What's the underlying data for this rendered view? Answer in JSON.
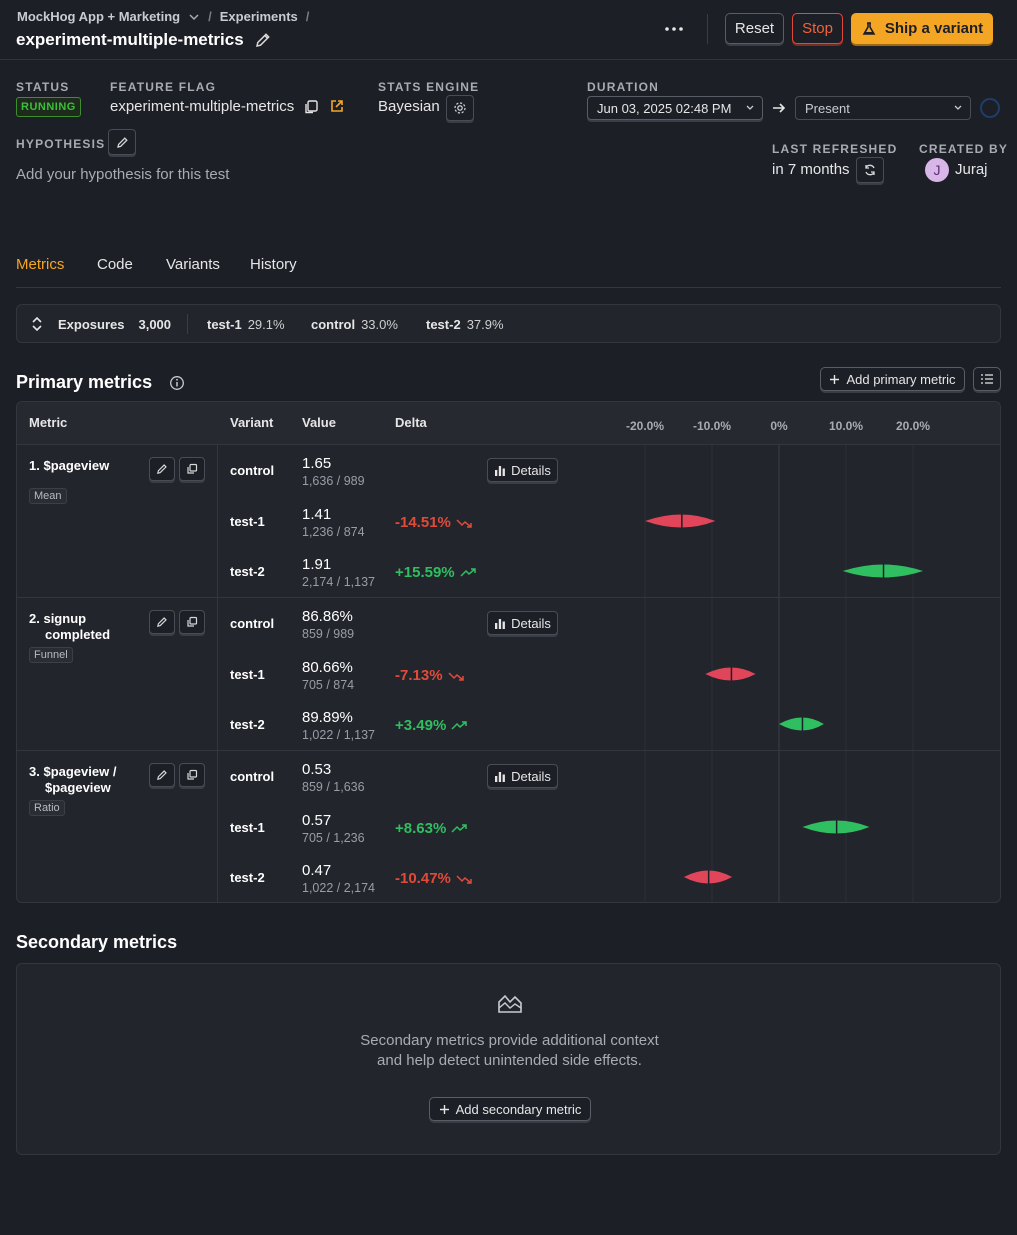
{
  "header": {
    "project": "MockHog App + Marketing",
    "breadcrumb_sep": "/",
    "section": "Experiments",
    "title": "experiment-multiple-metrics",
    "reset_label": "Reset",
    "stop_label": "Stop",
    "ship_label": "Ship a variant"
  },
  "info": {
    "status_label": "STATUS",
    "status_value": "RUNNING",
    "flag_label": "FEATURE FLAG",
    "flag_value": "experiment-multiple-metrics",
    "engine_label": "STATS ENGINE",
    "engine_value": "Bayesian",
    "duration_label": "DURATION",
    "start_date": "Jun 03, 2025 02:48 PM",
    "end_date": "Present",
    "hypothesis_label": "HYPOTHESIS",
    "hypothesis_placeholder": "Add your hypothesis for this test",
    "refreshed_label": "LAST REFRESHED",
    "refreshed_value": "in 7 months",
    "created_label": "CREATED BY",
    "creator_initial": "J",
    "creator_name": "Juraj"
  },
  "tabs": [
    "Metrics",
    "Code",
    "Variants",
    "History"
  ],
  "exposures": {
    "label": "Exposures",
    "total": "3,000",
    "items": [
      {
        "name": "test-1",
        "pct": "29.1%"
      },
      {
        "name": "control",
        "pct": "33.0%"
      },
      {
        "name": "test-2",
        "pct": "37.9%"
      }
    ]
  },
  "primary": {
    "title": "Primary metrics",
    "add_label": "Add primary metric",
    "columns": [
      "Metric",
      "Variant",
      "Value",
      "Delta"
    ],
    "axis_ticks": [
      "-20.0%",
      "-10.0%",
      "0%",
      "10.0%",
      "20.0%"
    ],
    "details_label": "Details",
    "metrics": [
      {
        "num": "1.",
        "name": "$pageview",
        "tag": "Mean",
        "rows": [
          {
            "variant": "control",
            "value": "1.65",
            "sub": "1,636 / 989",
            "delta": ""
          },
          {
            "variant": "test-1",
            "value": "1.41",
            "sub": "1,236 / 874",
            "delta": "-14.51%"
          },
          {
            "variant": "test-2",
            "value": "1.91",
            "sub": "2,174 / 1,137",
            "delta": "+15.59%"
          }
        ]
      },
      {
        "num": "2.",
        "name": "signup completed",
        "tag": "Funnel",
        "rows": [
          {
            "variant": "control",
            "value": "86.86%",
            "sub": "859 / 989",
            "delta": ""
          },
          {
            "variant": "test-1",
            "value": "80.66%",
            "sub": "705 / 874",
            "delta": "-7.13%"
          },
          {
            "variant": "test-2",
            "value": "89.89%",
            "sub": "1,022 / 1,137",
            "delta": "+3.49%"
          }
        ]
      },
      {
        "num": "3.",
        "name": "$pageview / $pageview",
        "tag": "Ratio",
        "rows": [
          {
            "variant": "control",
            "value": "0.53",
            "sub": "859 / 1,636",
            "delta": ""
          },
          {
            "variant": "test-1",
            "value": "0.57",
            "sub": "705 / 1,236",
            "delta": "+8.63%"
          },
          {
            "variant": "test-2",
            "value": "0.47",
            "sub": "1,022 / 2,174",
            "delta": "-10.47%"
          }
        ]
      }
    ]
  },
  "violins": {
    "axis_min": -0.2,
    "axis_max": 0.2,
    "items": [
      {
        "metric": 0,
        "row": 1,
        "low": -0.2,
        "mid": -0.145,
        "high": -0.095,
        "color": "#e0455a"
      },
      {
        "metric": 0,
        "row": 2,
        "low": 0.095,
        "mid": 0.156,
        "high": 0.215,
        "color": "#2fbf60"
      },
      {
        "metric": 1,
        "row": 1,
        "low": -0.11,
        "mid": -0.071,
        "high": -0.035,
        "color": "#e0455a"
      },
      {
        "metric": 1,
        "row": 2,
        "low": 0.0,
        "mid": 0.035,
        "high": 0.067,
        "color": "#2fbf60"
      },
      {
        "metric": 2,
        "row": 1,
        "low": 0.035,
        "mid": 0.086,
        "high": 0.135,
        "color": "#2fbf60"
      },
      {
        "metric": 2,
        "row": 2,
        "low": -0.142,
        "mid": -0.105,
        "high": -0.07,
        "color": "#e0455a"
      }
    ]
  },
  "secondary": {
    "title": "Secondary metrics",
    "empty_line1": "Secondary metrics provide additional context",
    "empty_line2": "and help detect unintended side effects.",
    "add_label": "Add secondary metric"
  },
  "colors": {
    "accent": "#f5a524",
    "positive": "#2fbf60",
    "negative": "#e04b39"
  }
}
